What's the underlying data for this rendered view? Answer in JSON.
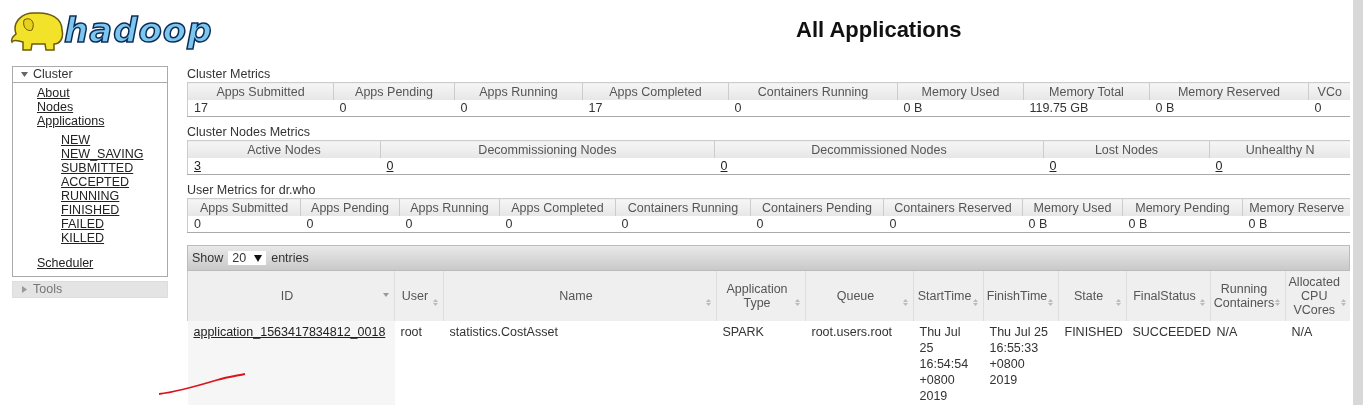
{
  "logo": {
    "text": "hadoop"
  },
  "page_title": "All Applications",
  "sidebar": [
    {
      "label": "Cluster",
      "expanded": true,
      "children": [
        {
          "label": "About"
        },
        {
          "label": "Nodes"
        },
        {
          "label": "Applications",
          "children": [
            {
              "label": "NEW"
            },
            {
              "label": "NEW_SAVING"
            },
            {
              "label": "SUBMITTED"
            },
            {
              "label": "ACCEPTED"
            },
            {
              "label": "RUNNING"
            },
            {
              "label": "FINISHED"
            },
            {
              "label": "FAILED"
            },
            {
              "label": "KILLED"
            }
          ]
        },
        {
          "label": "Scheduler"
        }
      ]
    },
    {
      "label": "Tools",
      "expanded": false
    }
  ],
  "metrics": [
    {
      "title": "Cluster Metrics",
      "linked": false,
      "columns": [
        "Apps Submitted",
        "Apps Pending",
        "Apps Running",
        "Apps Completed",
        "Containers Running",
        "Memory Used",
        "Memory Total",
        "Memory Reserved",
        "VCo"
      ],
      "values": [
        "17",
        "0",
        "0",
        "17",
        "0",
        "0 B",
        "119.75 GB",
        "0 B",
        "0"
      ]
    },
    {
      "title": "Cluster Nodes Metrics",
      "linked": true,
      "columns": [
        "Active Nodes",
        "Decommissioning Nodes",
        "Decommissioned Nodes",
        "Lost Nodes",
        "Unhealthy N"
      ],
      "values": [
        "3",
        "0",
        "0",
        "0",
        "0"
      ]
    },
    {
      "title": "User Metrics for dr.who",
      "linked": false,
      "columns": [
        "Apps Submitted",
        "Apps Pending",
        "Apps Running",
        "Apps Completed",
        "Containers Running",
        "Containers Pending",
        "Containers Reserved",
        "Memory Used",
        "Memory Pending",
        "Memory Reserve"
      ],
      "values": [
        "0",
        "0",
        "0",
        "0",
        "0",
        "0",
        "0",
        "0 B",
        "0 B",
        "0 B"
      ]
    }
  ],
  "applications": {
    "show_label": "Show",
    "page_size": "20",
    "entries_label": "entries",
    "columns": [
      {
        "label": "ID",
        "sorted": true
      },
      {
        "label": "User",
        "sorted": false
      },
      {
        "label": "Name",
        "sorted": false
      },
      {
        "label": "Application Type",
        "sorted": false
      },
      {
        "label": "Queue",
        "sorted": false
      },
      {
        "label": "StartTime",
        "sorted": false
      },
      {
        "label": "FinishTime",
        "sorted": false
      },
      {
        "label": "State",
        "sorted": false
      },
      {
        "label": "FinalStatus",
        "sorted": false
      },
      {
        "label": "Running Containers",
        "sorted": false
      },
      {
        "label": "Allocated CPU VCores",
        "sorted": false
      }
    ],
    "rows": [
      {
        "cells": [
          "application_1563417834812_0018",
          "root",
          "statistics.CostAsset",
          "SPARK",
          "root.users.root",
          "Thu Jul 25 16:54:54 +0800 2019",
          "Thu Jul 25 16:55:33 +0800 2019",
          "FINISHED",
          "SUCCEEDED",
          "N/A",
          "N/A"
        ]
      }
    ]
  }
}
